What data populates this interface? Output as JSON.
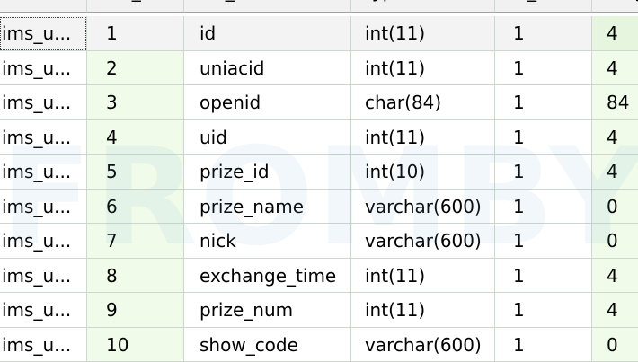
{
  "headers": [
    "table...",
    "col_n...",
    "col_name",
    "type",
    "is_nu...",
    "leng"
  ],
  "rows": [
    [
      "ims_u...",
      "1",
      "id",
      "int(11)",
      "1",
      "4"
    ],
    [
      "ims_u...",
      "2",
      "uniacid",
      "int(11)",
      "1",
      "4"
    ],
    [
      "ims_u...",
      "3",
      "openid",
      "char(84)",
      "1",
      "84"
    ],
    [
      "ims_u...",
      "4",
      "uid",
      "int(11)",
      "1",
      "4"
    ],
    [
      "ims_u...",
      "5",
      "prize_id",
      "int(10)",
      "1",
      "4"
    ],
    [
      "ims_u...",
      "6",
      "prize_name",
      "varchar(600)",
      "1",
      "0"
    ],
    [
      "ims_u...",
      "7",
      "nick",
      "varchar(600)",
      "1",
      "0"
    ],
    [
      "ims_u...",
      "8",
      "exchange_time",
      "int(11)",
      "1",
      "4"
    ],
    [
      "ims_u...",
      "9",
      "prize_num",
      "int(11)",
      "1",
      "4"
    ],
    [
      "ims_u...",
      "10",
      "show_code",
      "varchar(600)",
      "1",
      "0"
    ]
  ],
  "selected_row": 0,
  "watermark": "FROMBYTE",
  "colors": {
    "grid_line": "#cfd6cf",
    "alt_column": "#f0fbea",
    "selected_row": "#f3f3f3"
  }
}
